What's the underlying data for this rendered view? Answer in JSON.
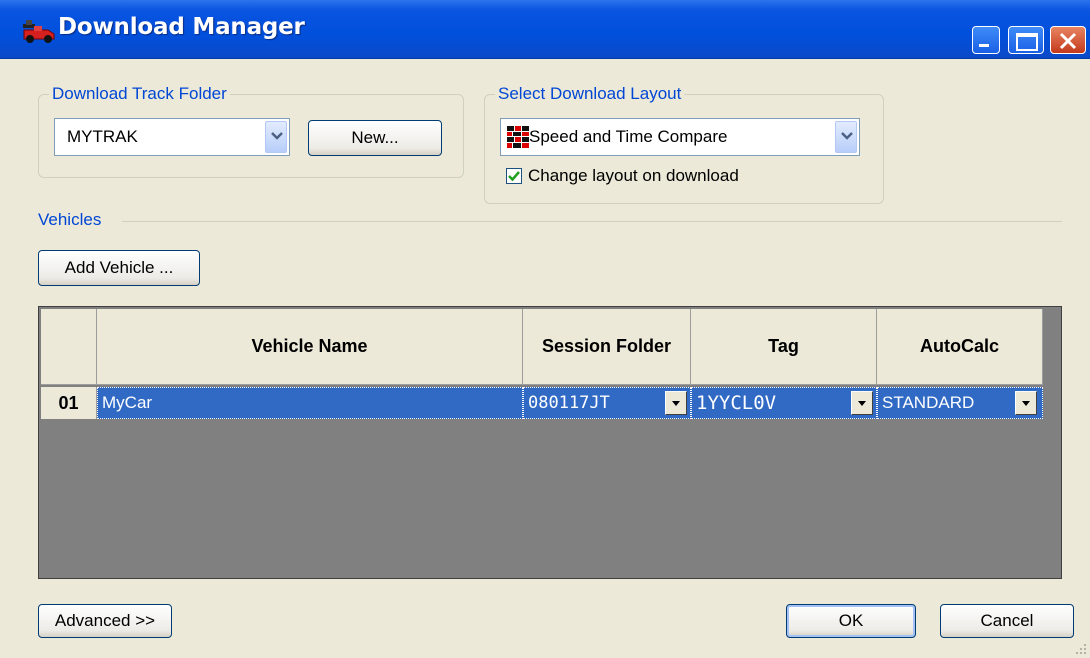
{
  "window": {
    "title": "Download Manager"
  },
  "track_folder": {
    "legend": "Download Track Folder",
    "selected": "MYTRAK",
    "new_button": "New..."
  },
  "layout": {
    "legend": "Select Download Layout",
    "selected": "Speed and Time Compare",
    "change_on_download_label": "Change layout on download",
    "change_on_download_checked": true
  },
  "vehicles": {
    "label": "Vehicles",
    "add_button": "Add Vehicle ...",
    "columns": [
      "Vehicle Name",
      "Session Folder",
      "Tag",
      "AutoCalc"
    ],
    "rows": [
      {
        "num": "01",
        "name": "MyCar",
        "session_folder": "080117JT",
        "tag": "1YYCL0V",
        "autocalc": "STANDARD"
      }
    ]
  },
  "footer": {
    "advanced_button": "Advanced >>",
    "ok_button": "OK",
    "cancel_button": "Cancel"
  }
}
